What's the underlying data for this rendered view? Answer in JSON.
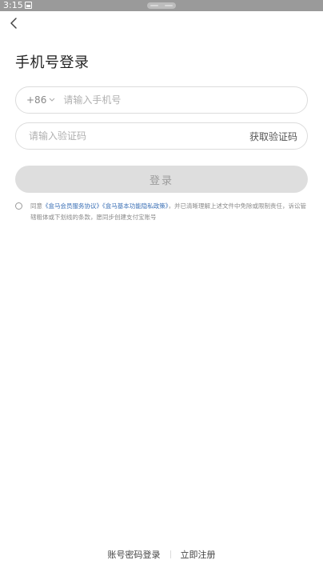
{
  "status_bar": {
    "time": "3:15"
  },
  "header": {
    "title": "手机号登录"
  },
  "phone_field": {
    "country_code": "+86",
    "placeholder": "请输入手机号",
    "value": ""
  },
  "code_field": {
    "placeholder": "请输入验证码",
    "value": "",
    "get_code_label": "获取验证码"
  },
  "login_button": {
    "label": "登录"
  },
  "agreement": {
    "prefix": "同意",
    "link1": "《盒马会员服务协议》",
    "link2": "《盒马基本功能隐私政策》",
    "suffix": "，并已清晰理解上述文件中免除或限制责任，诉讼管辖粗体或下划线的条款，愿同步创建支付宝账号",
    "checked": false
  },
  "footer": {
    "password_login": "账号密码登录",
    "register": "立即注册"
  },
  "colors": {
    "link": "#3a6fb5",
    "button_disabled": "#dedede",
    "border": "#dcdcdc"
  }
}
